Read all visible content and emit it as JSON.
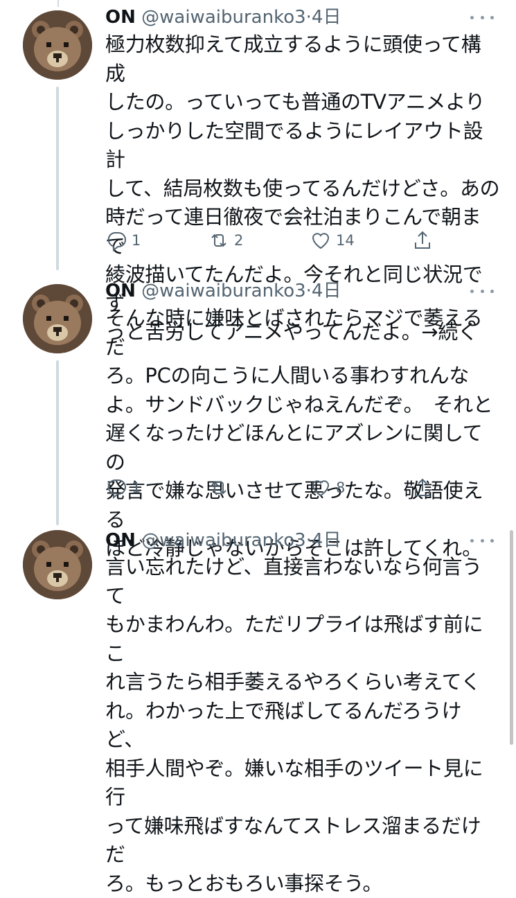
{
  "tweets": [
    {
      "name": "ON",
      "handle": "@waiwaiburanko3",
      "separator": "·",
      "time": "4日",
      "text": "極力枚数抑えて成立するように頭使って構成\nしたの。っていっても普通のTVアニメより\nしっかりした空間でるようにレイアウト設計\nして、結局枚数も使ってるんだけどさ。あの\n時だって連日徹夜で会社泊まりこんで朝まで\n綾波描いてたんだよ。今それと同じ状況でず\nっと苦労してアニメやってんだよ。→続く",
      "reply_count": "1",
      "retweet_count": "2",
      "like_count": "14"
    },
    {
      "name": "ON",
      "handle": "@waiwaiburanko3",
      "separator": "·",
      "time": "4日",
      "text": "そんな時に嫌味とばされたらマジで萎えるだ\nろ。PCの向こうに人間いる事わすれんな\nよ。サンドバックじゃねえんだぞ。　それと\n遅くなったけどほんとにアズレンに関しての\n発言で嫌な思いさせて悪ったな。敬語使える\nほど冷静じゃないからそこは許してくれ。",
      "reply_count": "1",
      "retweet_count": "",
      "like_count": "8"
    },
    {
      "name": "ON",
      "handle": "@waiwaiburanko3",
      "separator": "·",
      "time": "4日",
      "text": "言い忘れたけど、直接言わないなら何言うて\nもかまわんわ。ただリプライは飛ばす前にこ\nれ言うたら相手萎えるやろくらい考えてく\nれ。わかった上で飛ばしてるんだろうけど、\n相手人間やぞ。嫌いな相手のツイート見に行\nって嫌味飛ばすなんてストレス溜まるだけだ\nろ。もっとおもろい事探そう。"
    }
  ],
  "icons": {
    "avatar": "bear-avatar",
    "more": "more-dots-icon",
    "reply": "reply-bubble-icon",
    "retweet": "retweet-icon",
    "like": "heart-icon",
    "share": "share-icon"
  },
  "colors": {
    "text": "#0f1419",
    "secondary": "#536471",
    "thread_line": "#cfd9de",
    "avatar_fur": "#9a7a5e",
    "avatar_muzzle": "#d9c7a7"
  }
}
